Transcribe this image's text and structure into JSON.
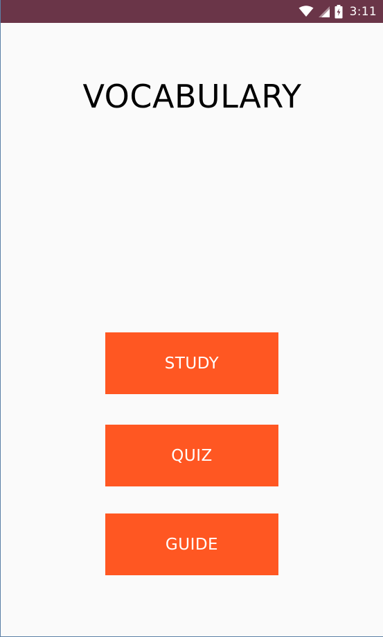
{
  "status_bar": {
    "time": "3:11",
    "icons": [
      "wifi-icon",
      "cell-signal-icon",
      "battery-charging-icon"
    ],
    "background_color": "#6a3548"
  },
  "main": {
    "title": "VOCABULARY",
    "buttons": [
      {
        "label": "STUDY"
      },
      {
        "label": "QUIZ"
      },
      {
        "label": "GUIDE"
      }
    ],
    "button_color": "#ff5722",
    "background_color": "#fafafa"
  }
}
